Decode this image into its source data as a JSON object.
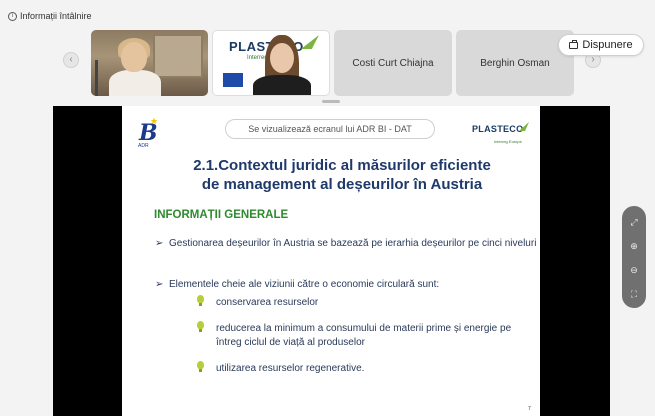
{
  "topbar": {
    "info_label": "Informații întâlnire",
    "info_icon": "info-icon"
  },
  "participants": {
    "nav_prev_icon": "chevron-left-icon",
    "nav_next_icon": "chevron-right-icon",
    "tiles": [
      {
        "type": "video",
        "name": ""
      },
      {
        "type": "video",
        "name": "",
        "logo_text": "PLASTECO",
        "logo_sub": "Interreg Europe"
      },
      {
        "type": "name",
        "name": "Costi Curt Chiajna"
      },
      {
        "type": "name",
        "name": "Berghin Osman"
      }
    ]
  },
  "present_button": {
    "label": "Dispunere",
    "icon": "layout-icon"
  },
  "slide": {
    "share_banner": "Se vizualizează ecranul lui ADR BI - DAT",
    "logo_left": {
      "letter": "B",
      "tag": "ADR"
    },
    "logo_right": {
      "word": "PLASTECO",
      "sub": "Interreg Europe"
    },
    "title_line1": "2.1.Contextul juridic al măsurilor eficiente",
    "title_line2": "de management al deșeurilor în Austria",
    "section_heading": "INFORMAȚII GENERALE",
    "bullets": [
      "Gestionarea deșeurilor în Austria se bazează pe ierarhia deșeurilor pe cinci niveluri",
      "Elementele cheie ale viziunii către o economie circulară sunt:"
    ],
    "sub_items": [
      "conservarea resurselor",
      "reducerea la minimum a consumului de materii prime și energie pe întreg ciclul de viață al produselor",
      "utilizarea resurselor regenerative."
    ],
    "page_number": "7"
  },
  "side_tools": [
    {
      "icon": "fullscreen-icon",
      "glyph": "⤢"
    },
    {
      "icon": "zoom-in-icon",
      "glyph": "⊕"
    },
    {
      "icon": "zoom-out-icon",
      "glyph": "⊖"
    },
    {
      "icon": "fit-icon",
      "glyph": "⛶"
    }
  ],
  "colors": {
    "title": "#1f3a6a",
    "section_heading": "#2e8b2e",
    "share_background": "#000000"
  }
}
